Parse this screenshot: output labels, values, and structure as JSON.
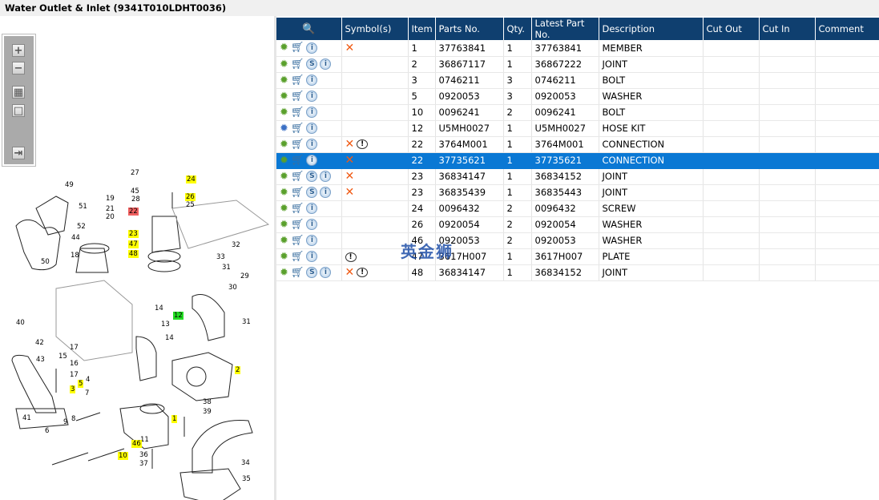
{
  "title": "Water Outlet & Inlet (9341T010LDHT0036)",
  "toolbar": {
    "icons": [
      "zoom-in-icon",
      "zoom-out-icon",
      "fit-all-icon",
      "actual-size-icon",
      "export-icon"
    ],
    "labels": [
      "+",
      "−",
      "▦",
      "□",
      "⇥"
    ]
  },
  "diagram": {
    "callouts": [
      "27",
      "24",
      "45",
      "28",
      "26",
      "25",
      "22",
      "49",
      "19",
      "51",
      "21",
      "20",
      "52",
      "44",
      "18",
      "50",
      "23",
      "47",
      "48",
      "32",
      "33",
      "31",
      "29",
      "30",
      "14",
      "12",
      "13",
      "14",
      "31",
      "40",
      "42",
      "43",
      "15",
      "17",
      "16",
      "17",
      "2",
      "3",
      "5",
      "4",
      "7",
      "41",
      "1",
      "38",
      "39",
      "9",
      "8",
      "6",
      "11",
      "46",
      "10",
      "36",
      "37",
      "34",
      "35"
    ],
    "highlight_colors": {
      "yellow": "#ffff00",
      "red": "#f06060",
      "green": "#22dd22"
    }
  },
  "table": {
    "columns": [
      "",
      "Symbol(s)",
      "Item",
      "Parts No.",
      "Qty.",
      "Latest Part No.",
      "Description",
      "Cut Out",
      "Cut In",
      "Comment"
    ],
    "rows": [
      {
        "gear": "green",
        "s": false,
        "sym": [
          "x"
        ],
        "item": "1",
        "part": "37763841",
        "qty": "1",
        "latest": "37763841",
        "desc": "MEMBER"
      },
      {
        "gear": "green",
        "s": true,
        "sym": [],
        "item": "2",
        "part": "36867117",
        "qty": "1",
        "latest": "36867222",
        "desc": "JOINT"
      },
      {
        "gear": "green",
        "s": false,
        "sym": [],
        "item": "3",
        "part": "0746211",
        "qty": "3",
        "latest": "0746211",
        "desc": "BOLT"
      },
      {
        "gear": "green",
        "s": false,
        "sym": [],
        "item": "5",
        "part": "0920053",
        "qty": "3",
        "latest": "0920053",
        "desc": "WASHER"
      },
      {
        "gear": "green",
        "s": false,
        "sym": [],
        "item": "10",
        "part": "0096241",
        "qty": "2",
        "latest": "0096241",
        "desc": "BOLT"
      },
      {
        "gear": "blue",
        "s": false,
        "sym": [],
        "item": "12",
        "part": "U5MH0027",
        "qty": "1",
        "latest": "U5MH0027",
        "desc": "HOSE KIT"
      },
      {
        "gear": "green",
        "s": false,
        "sym": [
          "x",
          "!"
        ],
        "item": "22",
        "part": "3764M001",
        "qty": "1",
        "latest": "3764M001",
        "desc": "CONNECTION"
      },
      {
        "gear": "green",
        "s": false,
        "sym": [
          "x"
        ],
        "item": "22",
        "part": "37735621",
        "qty": "1",
        "latest": "37735621",
        "desc": "CONNECTION",
        "selected": true
      },
      {
        "gear": "green",
        "s": true,
        "sym": [
          "x"
        ],
        "item": "23",
        "part": "36834147",
        "qty": "1",
        "latest": "36834152",
        "desc": "JOINT"
      },
      {
        "gear": "green",
        "s": true,
        "sym": [
          "x"
        ],
        "item": "23",
        "part": "36835439",
        "qty": "1",
        "latest": "36835443",
        "desc": "JOINT"
      },
      {
        "gear": "green",
        "s": false,
        "sym": [],
        "item": "24",
        "part": "0096432",
        "qty": "2",
        "latest": "0096432",
        "desc": "SCREW"
      },
      {
        "gear": "green",
        "s": false,
        "sym": [],
        "item": "26",
        "part": "0920054",
        "qty": "2",
        "latest": "0920054",
        "desc": "WASHER"
      },
      {
        "gear": "green",
        "s": false,
        "sym": [],
        "item": "46",
        "part": "0920053",
        "qty": "2",
        "latest": "0920053",
        "desc": "WASHER"
      },
      {
        "gear": "green",
        "s": false,
        "sym": [
          "!"
        ],
        "item": "47",
        "part": "3617H007",
        "qty": "1",
        "latest": "3617H007",
        "desc": "PLATE"
      },
      {
        "gear": "green",
        "s": true,
        "sym": [
          "x",
          "!"
        ],
        "item": "48",
        "part": "36834147",
        "qty": "1",
        "latest": "36834152",
        "desc": "JOINT"
      }
    ]
  },
  "watermark": "英金狮",
  "colors": {
    "header": "#0f3f6f",
    "selected": "#0a78d4",
    "gear": "#5aa02c",
    "x_mark": "#f05a14"
  }
}
